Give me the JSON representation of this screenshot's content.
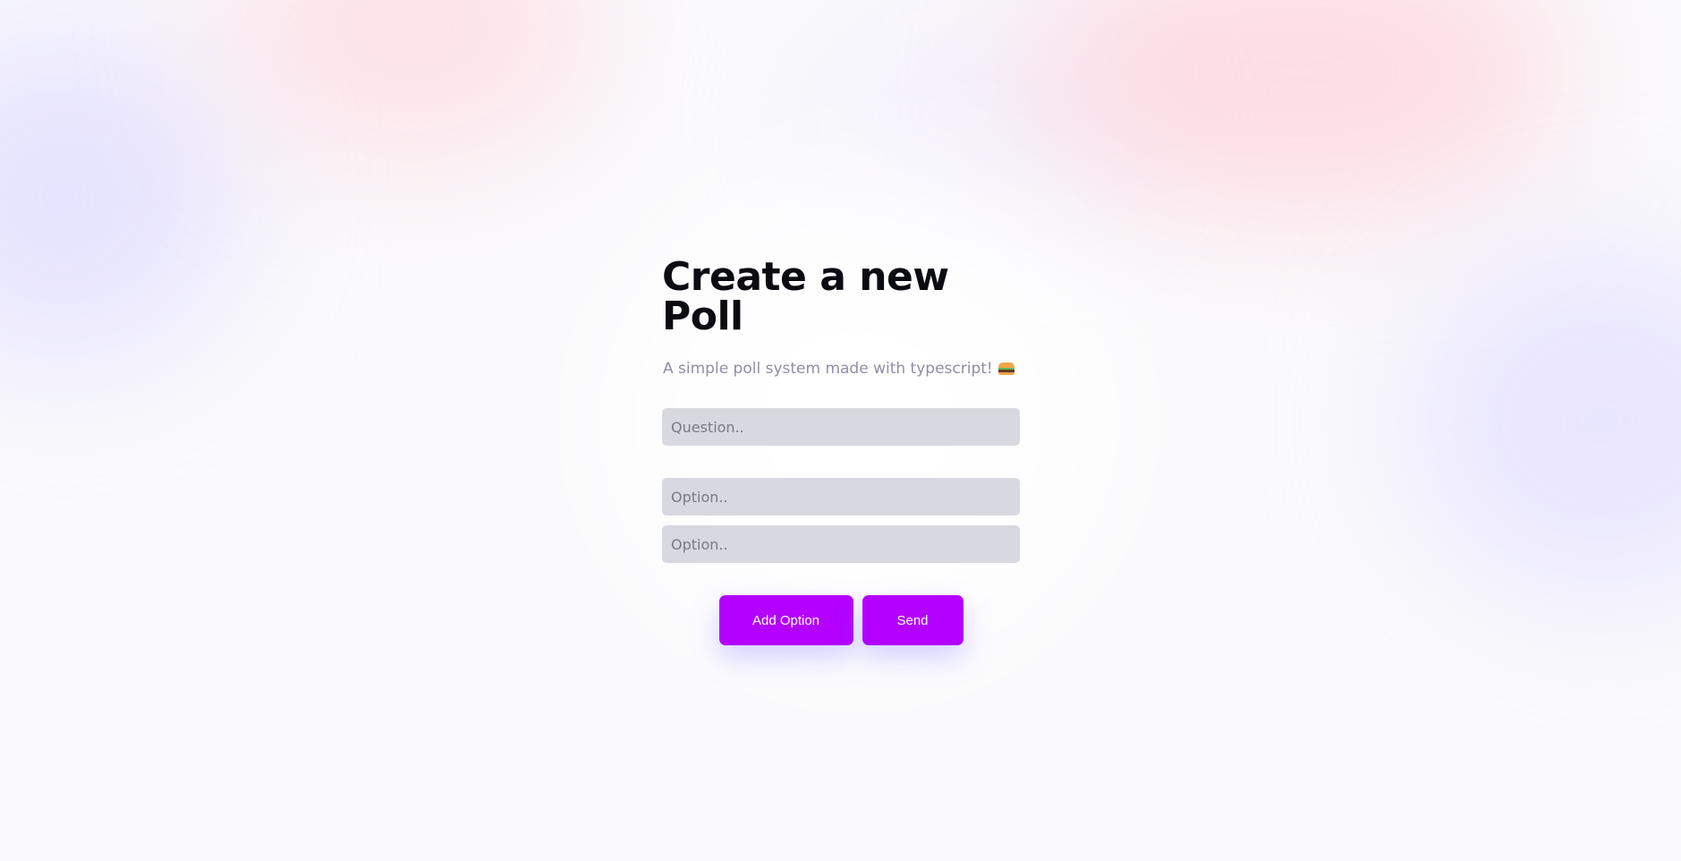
{
  "page": {
    "title": "Create a new Poll",
    "subtitle": "A simple poll system made with typescript!",
    "subtitle_emoji": "hamburger-icon"
  },
  "form": {
    "question_placeholder": "Question..",
    "options": [
      {
        "placeholder": "Option.."
      },
      {
        "placeholder": "Option.."
      }
    ],
    "add_option_label": "Add Option",
    "send_label": "Send"
  },
  "colors": {
    "accent": "#b300ff",
    "field_bg": "#d8d8e0",
    "title": "#0b0b12",
    "subtitle": "#8f8ea5"
  }
}
